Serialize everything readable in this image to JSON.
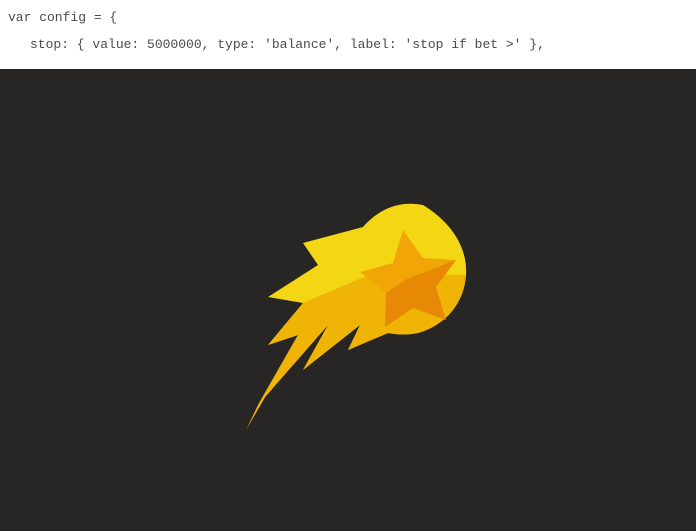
{
  "code": {
    "line1": "var config = {",
    "line2": "stop: { value: 5000000, type: 'balance', label: 'stop if bet >' },"
  },
  "icon": {
    "name": "comet-star",
    "colors": {
      "cometMain": "#f4d714",
      "cometShadow": "#efb406",
      "starMain": "#f1a507",
      "starShadow": "#e88906"
    }
  }
}
